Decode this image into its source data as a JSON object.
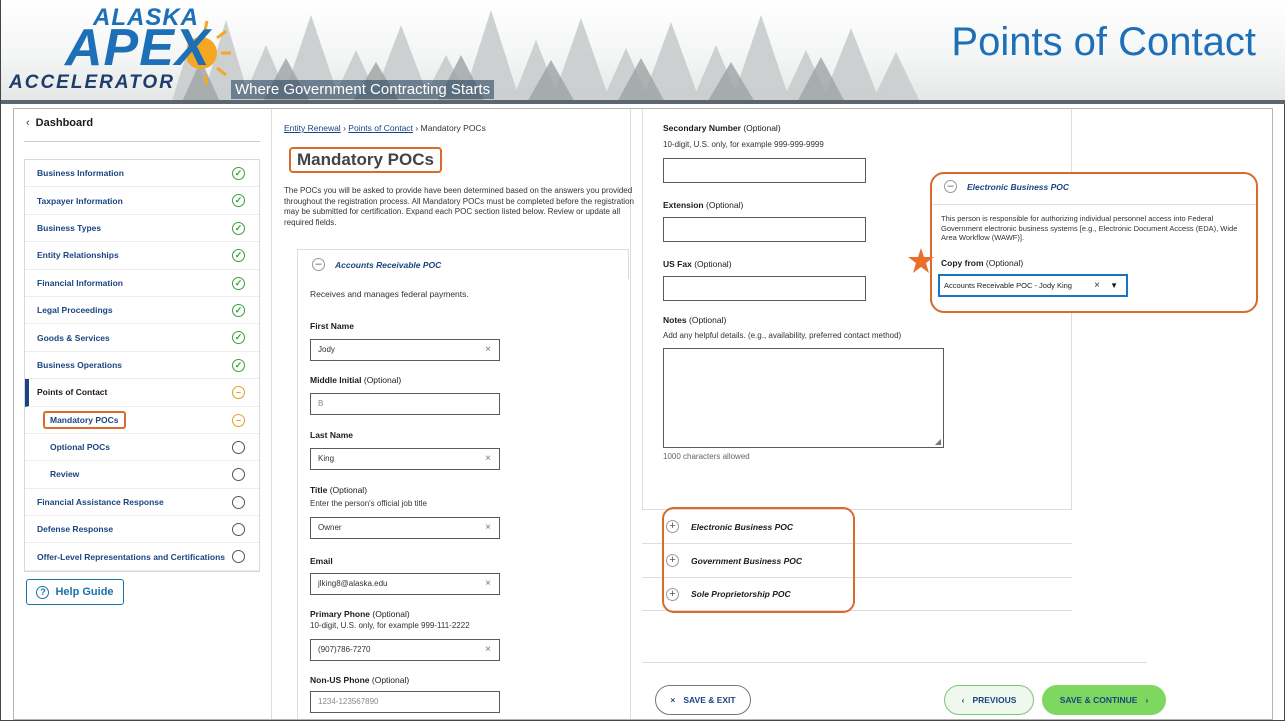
{
  "banner": {
    "logo_top": "ALASKA",
    "logo_main": "APEX",
    "logo_bottom": "ACCELERATOR",
    "tagline": "Where Government Contracting Starts",
    "title": "Points of Contact"
  },
  "sidebar": {
    "dashboard_label": "Dashboard",
    "items": [
      {
        "label": "Business Information",
        "status": "done"
      },
      {
        "label": "Taxpayer Information",
        "status": "done"
      },
      {
        "label": "Business Types",
        "status": "done"
      },
      {
        "label": "Entity Relationships",
        "status": "done"
      },
      {
        "label": "Financial Information",
        "status": "done"
      },
      {
        "label": "Legal Proceedings",
        "status": "done"
      },
      {
        "label": "Goods & Services",
        "status": "done"
      },
      {
        "label": "Business Operations",
        "status": "done"
      },
      {
        "label": "Points of Contact",
        "status": "in-progress"
      },
      {
        "label": "Mandatory POCs",
        "status": "in-progress"
      },
      {
        "label": "Optional POCs",
        "status": "not-started"
      },
      {
        "label": "Review",
        "status": "not-started"
      },
      {
        "label": "Financial Assistance Response",
        "status": "not-started"
      },
      {
        "label": "Defense Response",
        "status": "not-started"
      },
      {
        "label": "Offer-Level Representations and Certifications",
        "status": "not-started"
      }
    ],
    "help_label": "Help Guide"
  },
  "breadcrumb": {
    "link1": "Entity Renewal",
    "link2": "Points of Contact",
    "current": "Mandatory POCs",
    "sep": "›"
  },
  "page": {
    "heading": "Mandatory POCs",
    "intro": "The POCs you will be asked to provide have been determined based on the answers you provided throughout the registration process. All Mandatory POCs must be completed before the registration may be submitted for certification. Expand each POC section listed below. Review or update all required fields."
  },
  "ar_poc": {
    "title": "Accounts Receivable POC",
    "description": "Receives and manages federal payments.",
    "first_name_label": "First Name",
    "first_name_value": "Jody",
    "middle_label": "Middle Initial",
    "middle_placeholder": "B",
    "last_name_label": "Last Name",
    "last_name_value": "King",
    "title_label": "Title",
    "title_hint": "Enter the person's official job title",
    "title_value": "Owner",
    "email_label": "Email",
    "email_value": "jlking8@alaska.edu",
    "primary_phone_label": "Primary Phone",
    "primary_phone_hint": "10-digit, U.S. only, for example 999-111-2222",
    "primary_phone_value": "(907)786-7270",
    "non_us_label": "Non-US Phone",
    "non_us_placeholder": "1234-123567890"
  },
  "optional_tag": "(Optional)",
  "right": {
    "secondary_label": "Secondary Number",
    "secondary_hint": "10-digit, U.S. only, for example 999-999-9999",
    "extension_label": "Extension",
    "fax_label": "US Fax",
    "notes_label": "Notes",
    "notes_hint": "Add any helpful details. (e.g., availability, preferred contact method)",
    "notes_counter": "1000 characters allowed",
    "sections": [
      "Electronic Business POC",
      "Government Business POC",
      "Sole Proprietorship POC"
    ],
    "save_exit": "SAVE & EXIT",
    "previous": "PREVIOUS",
    "save_continue": "SAVE & CONTINUE"
  },
  "callout": {
    "title": "Electronic Business POC",
    "description": "This person is responsible for authorizing individual personnel access into Federal Government electronic business systems [e.g., Electronic Document Access (EDA), Wide Area Workflow (WAWF)].",
    "copy_label": "Copy from",
    "copy_value": "Accounts Receivable POC - Jody King"
  },
  "colors": {
    "brand_blue": "#1d6fb8",
    "link_blue": "#1a4480",
    "highlight_orange": "#d86a2e",
    "success_green": "#3aa03a",
    "progress_amber": "#e0a020",
    "continue_green": "#7ed85f"
  }
}
